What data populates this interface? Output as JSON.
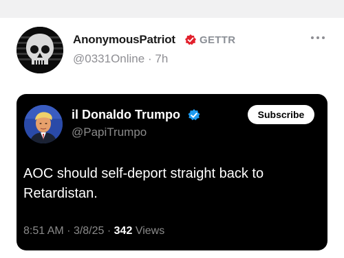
{
  "post": {
    "author_name": "AnonymousPatriot",
    "platform_label": "GETTR",
    "author_handle": "@0331Online",
    "separator": "·",
    "post_age": "7h"
  },
  "embedded_post": {
    "author_name": "il Donaldo Trumpo",
    "author_handle": "@PapiTrumpo",
    "subscribe_label": "Subscribe",
    "text": "AOC should self-deport straight back to Retardistan.",
    "time": "8:51 AM",
    "date": "3/8/25",
    "separator": "·",
    "views_count": "342",
    "views_label": "Views"
  },
  "icons": {
    "avatar": "skull-flag-avatar",
    "verified_author": "red-verified-badge-icon",
    "verified_embed": "blue-verified-badge-icon",
    "more": "more-options-icon"
  },
  "colors": {
    "badge_red": "#e2202c",
    "badge_blue": "#1d9bf0",
    "card_background": "#000000"
  }
}
